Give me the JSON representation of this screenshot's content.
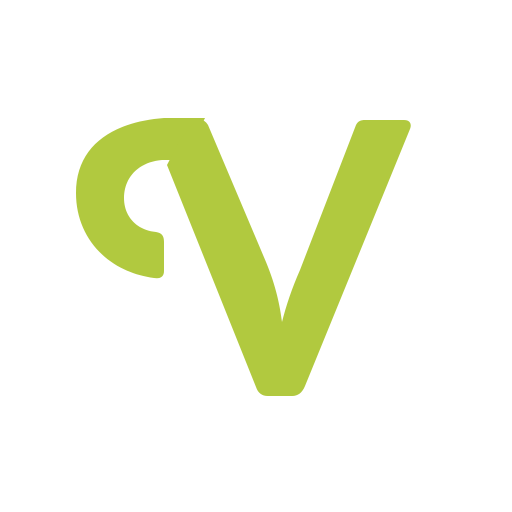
{
  "logo": {
    "icon": "letter-v-logo-icon",
    "color": "#B1C93F",
    "background": "#FFFFFF"
  }
}
